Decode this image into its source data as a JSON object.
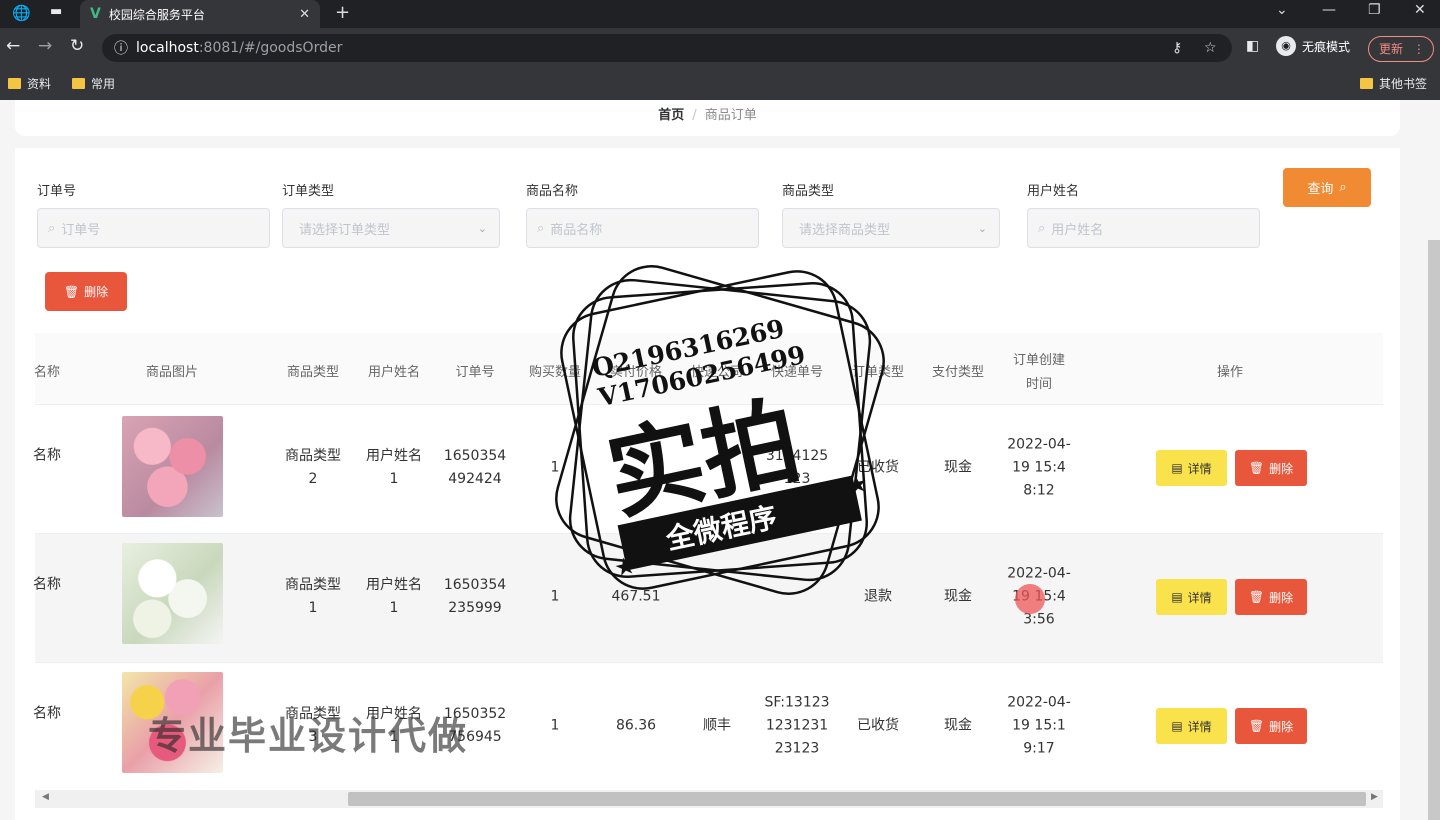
{
  "browser": {
    "tab_title": "校园综合服务平台",
    "url_host": "localhost",
    "url_rest": ":8081/#/goodsOrder",
    "incognito_label": "无痕模式",
    "update_label": "更新",
    "bookmarks": [
      "资料",
      "常用"
    ],
    "other_bookmarks": "其他书签"
  },
  "breadcrumb": {
    "home": "首页",
    "separator": "/",
    "current": "商品订单"
  },
  "filters": {
    "order_no": {
      "label": "订单号",
      "placeholder": "订单号"
    },
    "order_type": {
      "label": "订单类型",
      "placeholder": "请选择订单类型"
    },
    "goods_name": {
      "label": "商品名称",
      "placeholder": "商品名称"
    },
    "goods_type": {
      "label": "商品类型",
      "placeholder": "请选择商品类型"
    },
    "user_name": {
      "label": "用户姓名",
      "placeholder": "用户姓名"
    },
    "query_label": "查询",
    "delete_label": "删除"
  },
  "table": {
    "headers": [
      "名称",
      "商品图片",
      "商品类型",
      "用户姓名",
      "订单号",
      "购买数量",
      "实付价格",
      "快递公司",
      "快递单号",
      "订单类型",
      "支付类型",
      "订单创建时间",
      "操作"
    ],
    "detail_label": "详情",
    "delete_label": "删除",
    "rows": [
      {
        "name": "名称",
        "type": "商品类型2",
        "user": "用户姓名1",
        "order_no": "1650354492424",
        "qty": "1",
        "price": "",
        "express": "",
        "tracking": "3124125123",
        "order_type": "已收货",
        "pay": "现金",
        "created": "2022-04-19 15:48:12"
      },
      {
        "name": "名称",
        "type": "商品类型1",
        "user": "用户姓名1",
        "order_no": "1650354235999",
        "qty": "1",
        "price": "467.51",
        "express": "",
        "tracking": "",
        "order_type": "退款",
        "pay": "现金",
        "created": "2022-04-19 15:43:56"
      },
      {
        "name": "名称",
        "type": "商品类型3",
        "user": "用户姓名1",
        "order_no": "1650352756945",
        "qty": "1",
        "price": "86.36",
        "express": "顺丰",
        "tracking": "SF:13123123123123123",
        "order_type": "已收货",
        "pay": "现金",
        "created": "2022-04-19 15:19:17"
      }
    ]
  },
  "overlay": {
    "seal_line1": "Q2196316269",
    "seal_line2": "V17060256499",
    "seal_main": "实拍",
    "seal_banner": "全微程序",
    "watermark": "专业毕业设计代做"
  }
}
